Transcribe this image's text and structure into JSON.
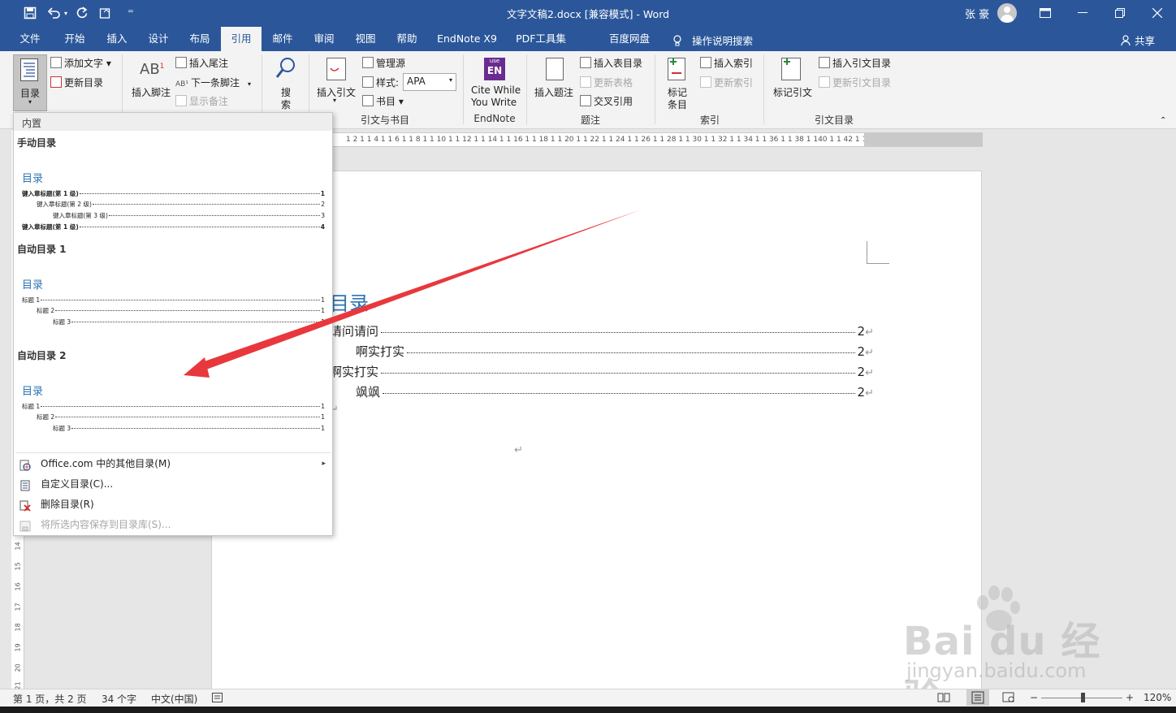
{
  "window": {
    "title": "文字文稿2.docx [兼容模式]  -  Word",
    "user": "张 豪",
    "accent": "#2b579a"
  },
  "quick_access": {
    "more": "⁼"
  },
  "tabs": [
    "文件",
    "开始",
    "插入",
    "设计",
    "布局",
    "引用",
    "邮件",
    "审阅",
    "视图",
    "帮助",
    "EndNote X9",
    "PDF工具集",
    "百度网盘"
  ],
  "active_tab": "引用",
  "tell_me": "操作说明搜索",
  "share": "共享",
  "ribbon": {
    "toc_button": "目录",
    "add_text": "添加文字 ▾",
    "update_toc": "更新目录",
    "insert_footnote": "插入脚注",
    "insert_endnote": "插入尾注",
    "next_footnote": "下一条脚注",
    "show_notes": "显示备注",
    "search_l1": "搜",
    "search_l2": "索",
    "insert_citation": "插入引文",
    "manage_sources": "管理源",
    "style_label": "样式:",
    "style_value": "APA",
    "bibliography": "书目 ▾",
    "group_citations": "引文与书目",
    "cwyw_l1": "Cite While",
    "cwyw_l2": "You Write",
    "group_endnote": "EndNote",
    "insert_caption": "插入题注",
    "insert_tof": "插入表目录",
    "update_table": "更新表格",
    "cross_ref": "交叉引用",
    "group_captions": "题注",
    "mark_entry_l1": "标记",
    "mark_entry_l2": "条目",
    "insert_index": "插入索引",
    "update_index": "更新索引",
    "group_index": "索引",
    "mark_citation": "标记引文",
    "insert_toa": "插入引文目录",
    "update_toa": "更新引文目录",
    "group_toa": "引文目录",
    "endnote_icon_top": "use",
    "endnote_icon_main": "EN"
  },
  "ruler_text": "1 2 1  1 4 1  1 6 1  1 8 1  1 10 1  1 12 1  1 14 1  1 16 1  1 18 1  1 20 1  1 22 1  1 24 1  1 26 1  1 28 1  1 30 1  1 32 1  1 34 1  1 36 1  1 38 1  140 1  1 42 1  1 44 1  1 46 1  148",
  "vruler_numbers": [
    "14",
    "15",
    "16",
    "17",
    "18",
    "19",
    "20",
    "21"
  ],
  "dropdown": {
    "header": "内置",
    "sections": [
      {
        "label": "手动目录",
        "title": "目录",
        "lines": [
          {
            "text": "键入章标题(第 1 级)",
            "page": "1"
          },
          {
            "text": "键入章标题(第 2 级)",
            "page": "2"
          },
          {
            "text": "键入章标题(第 3 级)",
            "page": "3"
          },
          {
            "text": "键入章标题(第 1 级)",
            "page": "4"
          }
        ]
      },
      {
        "label": "自动目录 1",
        "title": "目录",
        "lines": [
          {
            "text": "标题 1",
            "page": "1"
          },
          {
            "text": "标题 2",
            "page": "1"
          },
          {
            "text": "标题 3",
            "page": "1"
          }
        ]
      },
      {
        "label": "自动目录 2",
        "title": "目录",
        "lines": [
          {
            "text": "标题 1",
            "page": "1"
          },
          {
            "text": "标题 2",
            "page": "1"
          },
          {
            "text": "标题 3",
            "page": "1"
          }
        ]
      }
    ],
    "menu": [
      {
        "label": "Office.com 中的其他目录(M)",
        "disabled": false,
        "submenu": "▸"
      },
      {
        "label": "自定义目录(C)...",
        "disabled": false
      },
      {
        "label": "删除目录(R)",
        "disabled": false
      },
      {
        "label": "将所选内容保存到目录库(S)...",
        "disabled": true
      }
    ]
  },
  "document": {
    "toc_heading": "目录",
    "para_mark": "↵",
    "entries": [
      {
        "text": "请问请问",
        "page": "2"
      },
      {
        "text": "啊实打实",
        "page": "2"
      },
      {
        "text": "啊实打实",
        "page": "2"
      },
      {
        "text": "飒飒",
        "page": "2"
      }
    ]
  },
  "statusbar": {
    "page": "第 1 页，共 2 页",
    "words": "34 个字",
    "language": "中文(中国)",
    "zoom": "120%",
    "zoom_minus": "−",
    "zoom_plus": "+"
  },
  "watermark": {
    "main": "Bai du 经验",
    "sub": "jingyan.baidu.com"
  },
  "annotation_color": "#e8383d"
}
